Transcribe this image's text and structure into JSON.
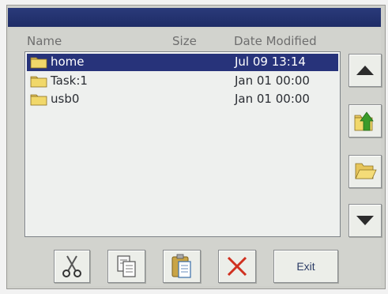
{
  "header": {
    "columns": [
      "Name",
      "Size",
      "Date Modified"
    ]
  },
  "files": [
    {
      "name": "home",
      "size": "",
      "date": "Jul 09 13:14",
      "selected": true,
      "icon": "folder-icon"
    },
    {
      "name": "Task:1",
      "size": "",
      "date": "Jan 01 00:00",
      "selected": false,
      "icon": "folder-icon"
    },
    {
      "name": "usb0",
      "size": "",
      "date": "Jan 01 00:00",
      "selected": false,
      "icon": "folder-icon"
    }
  ],
  "side_buttons": [
    {
      "name": "scroll-up-button",
      "icon": "triangle-up-icon"
    },
    {
      "name": "parent-folder-button",
      "icon": "folder-up-arrow-icon"
    },
    {
      "name": "open-folder-button",
      "icon": "open-folder-icon"
    },
    {
      "name": "scroll-down-button",
      "icon": "triangle-down-icon"
    }
  ],
  "toolbar": {
    "cut_icon": "scissors-icon",
    "copy_icon": "copy-icon",
    "paste_icon": "paste-icon",
    "delete_icon": "red-x-icon",
    "exit_label": "Exit"
  },
  "colors": {
    "selection": "#27337a",
    "titlebar": "#1e2c66",
    "delete_red": "#d0301f",
    "arrow_green": "#3a9a2a"
  }
}
